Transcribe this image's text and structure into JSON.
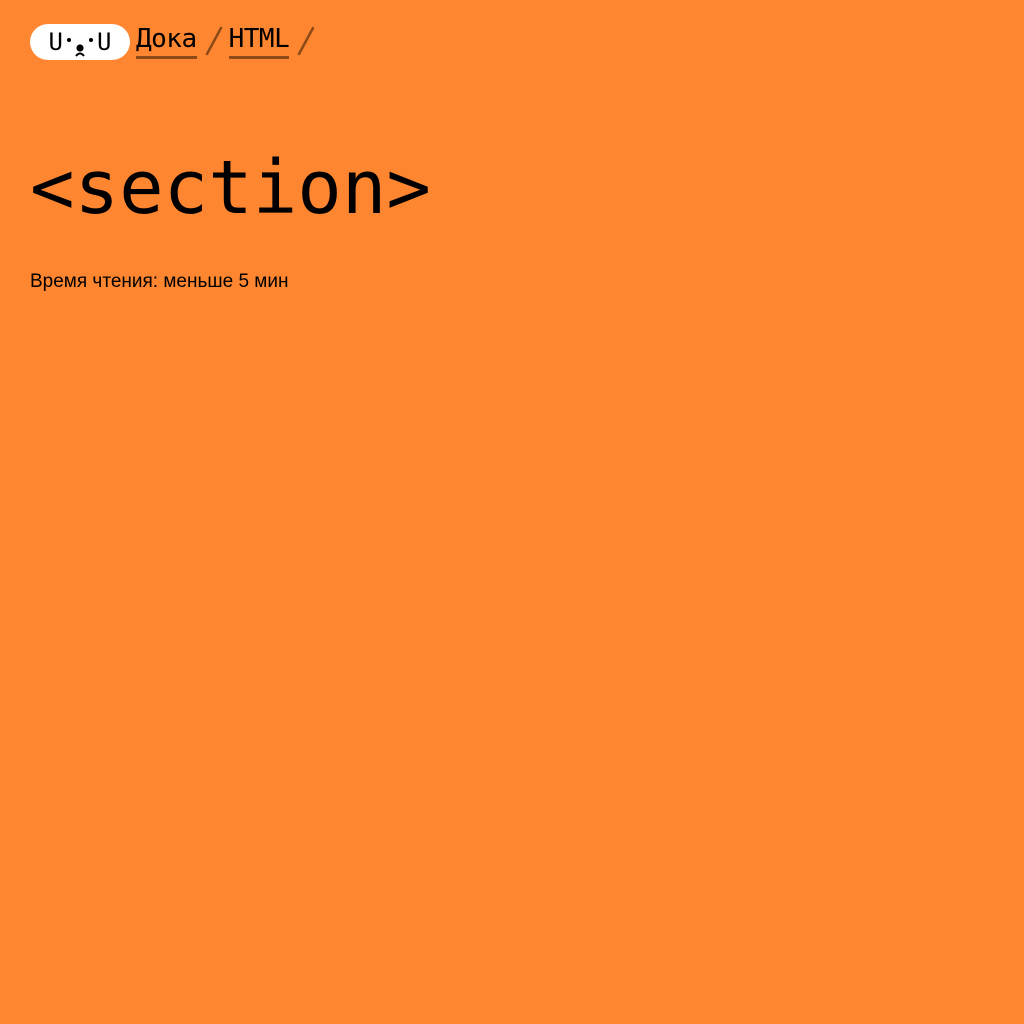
{
  "header": {
    "logo": {
      "left_char": "U",
      "right_char": "U",
      "icon": "doka-face-logo"
    },
    "breadcrumbs": [
      {
        "label": "Дока"
      },
      {
        "label": "HTML"
      }
    ],
    "separator_icon": "slash-icon"
  },
  "article": {
    "title": "<section>",
    "reading_time_label": "Время чтения: меньше 5 мин"
  },
  "colors": {
    "background": "#ff8630",
    "text": "#000000",
    "logo_background": "#ffffff",
    "link_underline": "#8b4a17",
    "separator": "#8b4a17"
  }
}
